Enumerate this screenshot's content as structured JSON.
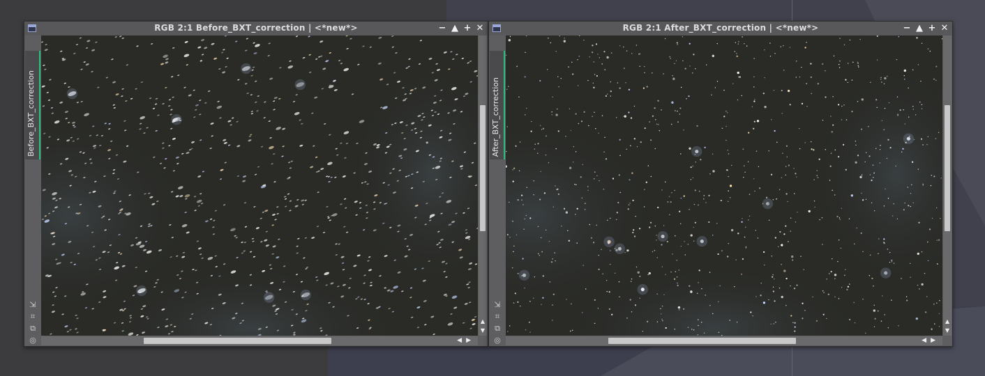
{
  "windows": [
    {
      "title": "RGB 2:1 Before_BXT_correction | <*new*>",
      "side_label": "Before_BXT_correction",
      "image_style": "soft",
      "vscroll_fraction": [
        0.25,
        0.7
      ],
      "hscroll_fraction": [
        0.25,
        0.71
      ],
      "seed": 7
    },
    {
      "title": "RGB 2:1 After_BXT_correction | <*new*>",
      "side_label": "After_BXT_correction",
      "image_style": "sharp",
      "vscroll_fraction": [
        0.25,
        0.7
      ],
      "hscroll_fraction": [
        0.25,
        0.71
      ],
      "seed": 11
    }
  ],
  "window_buttons": {
    "minimize": "−",
    "shade": "▲",
    "maximize": "+",
    "close": "✕"
  },
  "side_tool_icons": [
    "zoom-fit-icon",
    "crop-icon",
    "clone-icon",
    "target-icon"
  ],
  "colors": {
    "sky": "#2a2b27",
    "nebula": "#3b4144",
    "tab_accent": "#27c07a"
  }
}
